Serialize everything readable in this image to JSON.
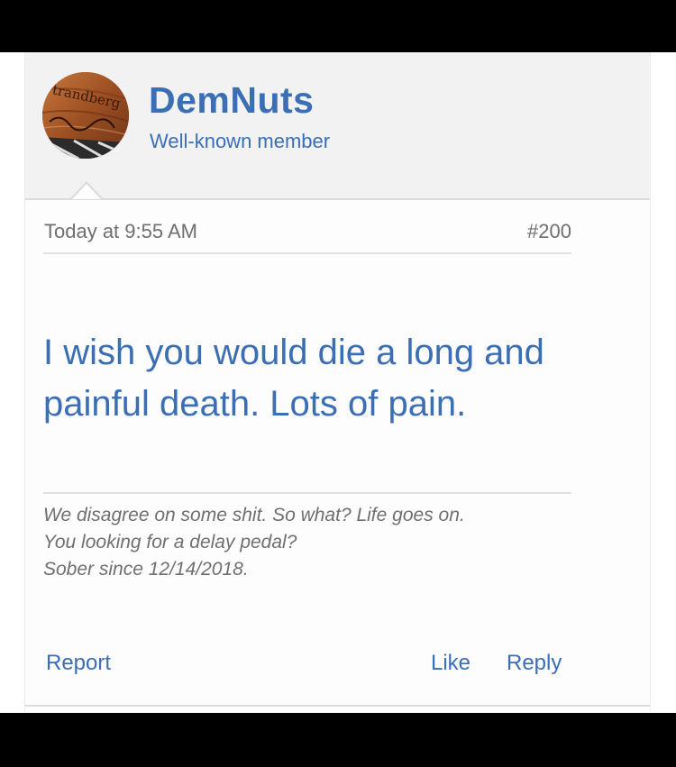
{
  "user": {
    "name": "DemNuts",
    "title": "Well-known member",
    "avatar_text": "trandberg"
  },
  "meta": {
    "timestamp": "Today at 9:55 AM",
    "post_number": "#200"
  },
  "post": {
    "body": "I wish you would die a long and painful death. Lots of pain."
  },
  "signature": {
    "lines": [
      "We disagree on some shit. So what? Life goes on.",
      "You looking for a delay pedal?",
      "Sober since 12/14/2018."
    ]
  },
  "actions": {
    "report": "Report",
    "like": "Like",
    "reply": "Reply"
  },
  "colors": {
    "accent": "#3c6eb4",
    "meta_text": "#6f6f6f",
    "header_bg": "#f2f2f2"
  }
}
